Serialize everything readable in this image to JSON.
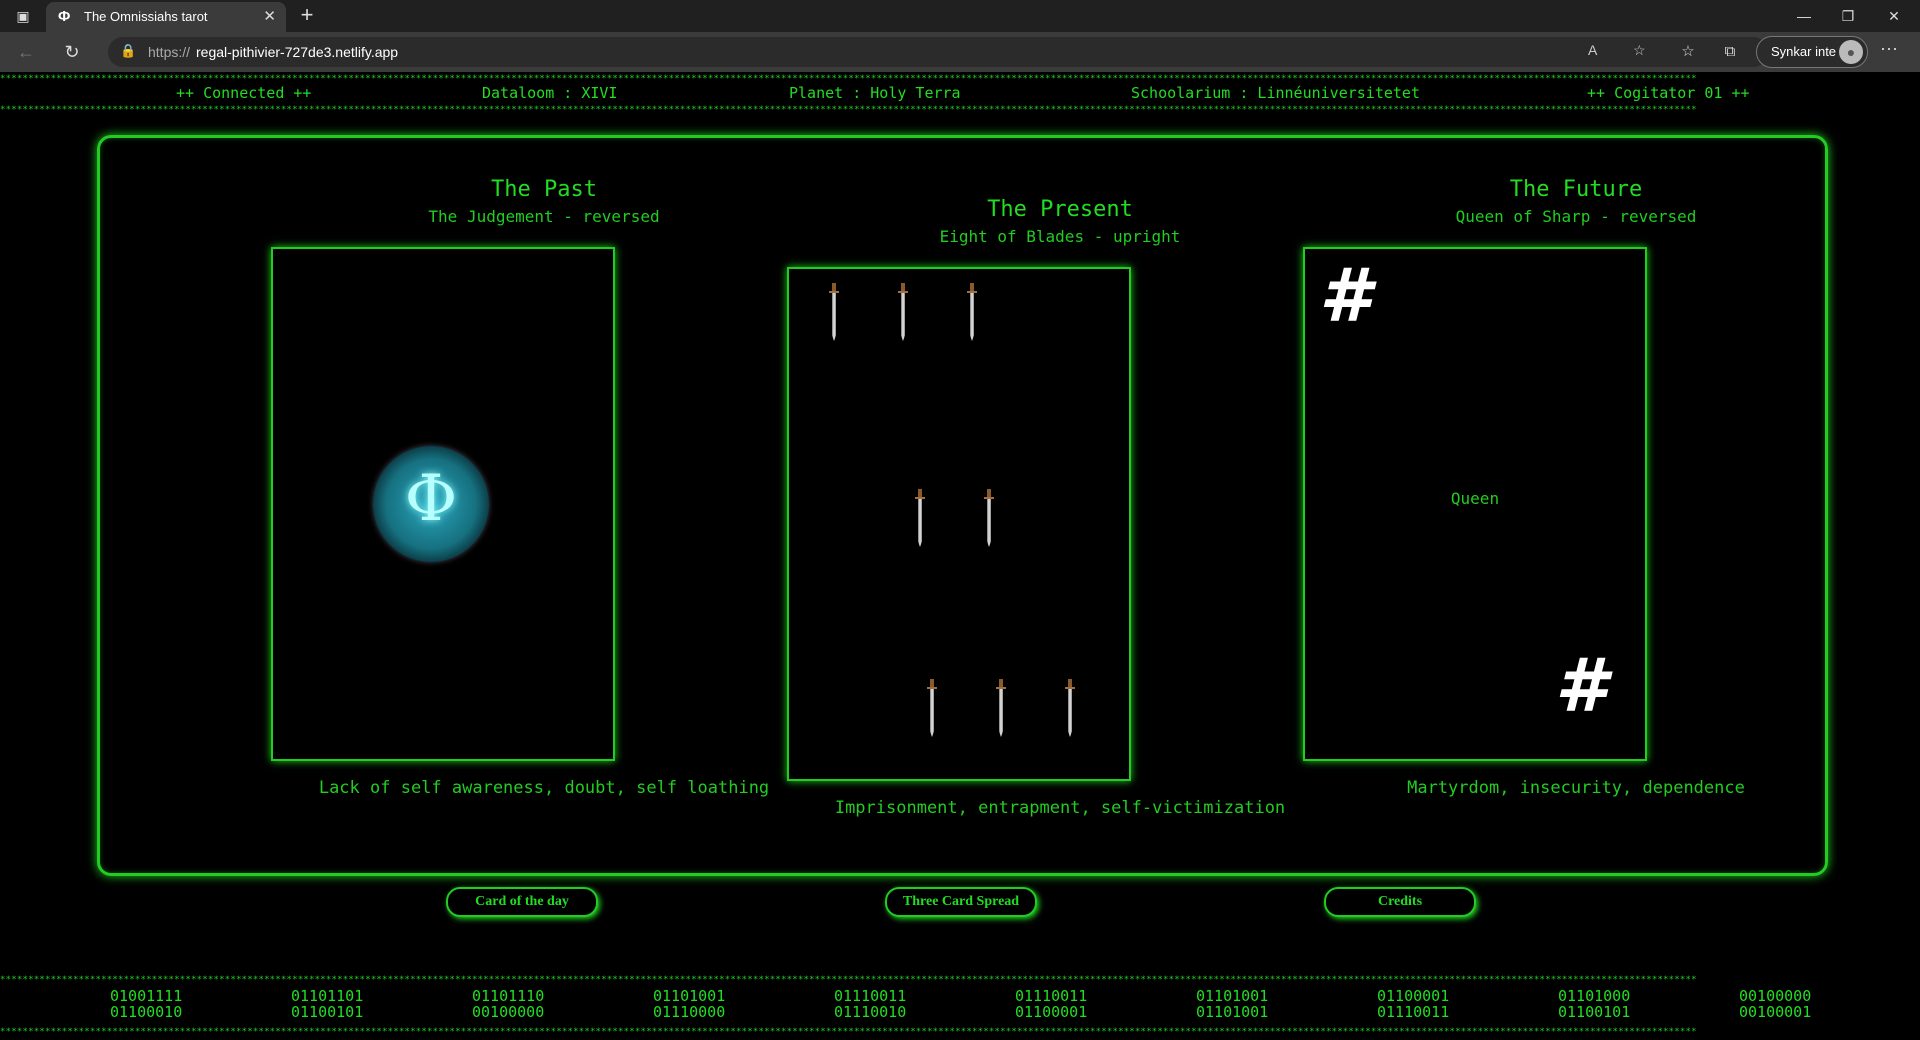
{
  "browser": {
    "tab_title": "The Omnissiahs tarot",
    "tab_favicon": "Φ",
    "url_protocol": "https://",
    "url_host": "regal-pithivier-727de3.netlify.app",
    "sync_label": "Synkar inte"
  },
  "status": {
    "connected": "++ Connected ++",
    "dataloom": "Dataloom : XIVI",
    "planet": "Planet : Holy Terra",
    "schoolarium": "Schoolarium : Linnéuniversitetet",
    "cogitator": "++ Cogitator 01 ++"
  },
  "star_row": "**************************************************************************************************************************************************************************************************************************************************************************************************************",
  "spread": {
    "past": {
      "title": "The Past",
      "card": "The Judgement - reversed",
      "description": "Lack of self awareness, doubt, self loathing",
      "emblem_glyph": "Φ"
    },
    "present": {
      "title": "The Present",
      "card": "Eight of Blades - upright",
      "description": "Imprisonment, entrapment, self-victimization"
    },
    "future": {
      "title": "The Future",
      "card": "Queen of Sharp - reversed",
      "description": "Martyrdom, insecurity, dependence",
      "corner_symbol": "#",
      "center_label": "Queen"
    }
  },
  "buttons": {
    "card_of_day": "Card of the day",
    "three_card": "Three Card Spread",
    "credits": "Credits"
  },
  "binary": [
    [
      "01001111",
      "01100010"
    ],
    [
      "01101101",
      "01100101"
    ],
    [
      "01101110",
      "00100000"
    ],
    [
      "01101001",
      "01110000"
    ],
    [
      "01110011",
      "01110010"
    ],
    [
      "01110011",
      "01100001"
    ],
    [
      "01101001",
      "01101001"
    ],
    [
      "01100001",
      "01110011"
    ],
    [
      "01101000",
      "01100101"
    ],
    [
      "00100000",
      "00100001"
    ]
  ],
  "colors": {
    "accent": "#22cc22",
    "background": "#000000"
  }
}
